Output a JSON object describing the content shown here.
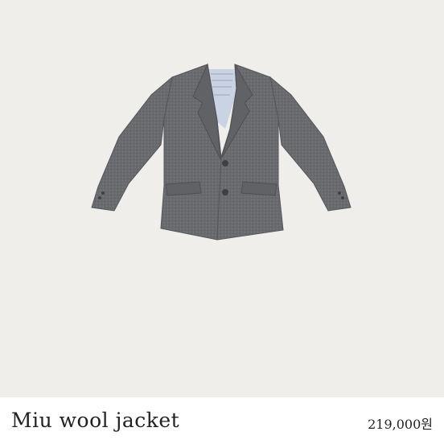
{
  "product": {
    "name": "Miu wool jacket",
    "price": "219,000원",
    "image_background": "#f0eeeb",
    "jacket_color": "#6b6c70",
    "lining_color": "#c9d3e3"
  }
}
